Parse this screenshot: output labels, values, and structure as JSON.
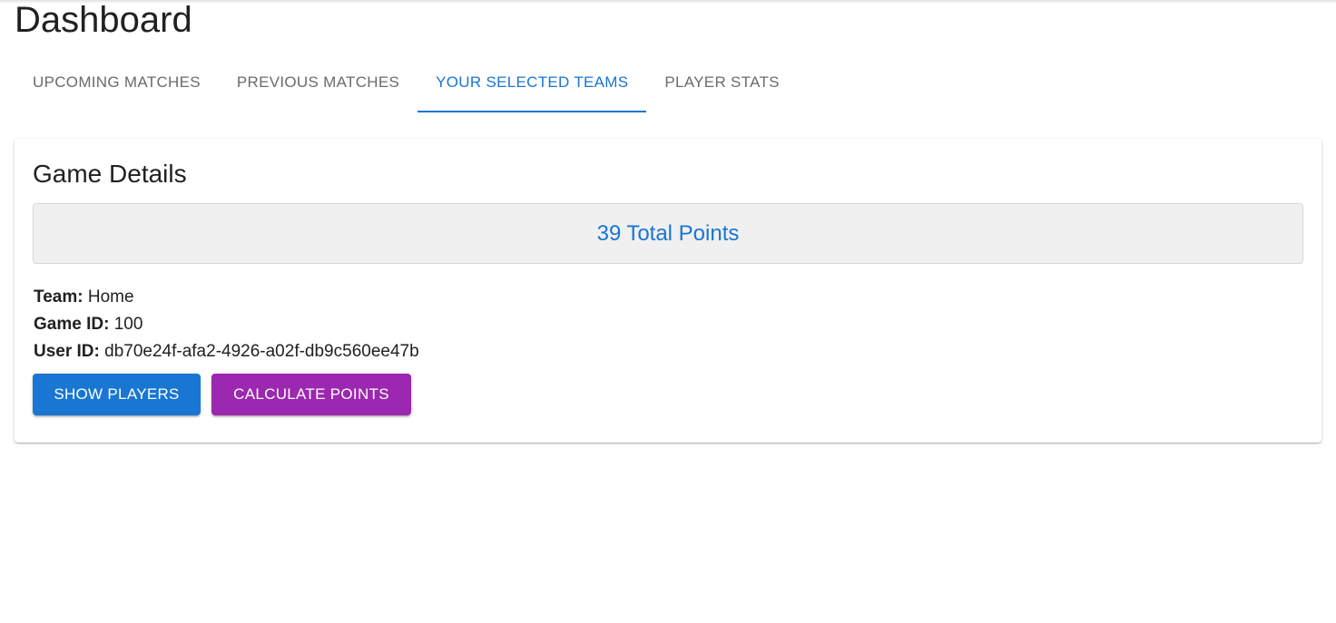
{
  "page": {
    "title": "Dashboard"
  },
  "tabs": [
    {
      "label": "UPCOMING MATCHES",
      "active": false
    },
    {
      "label": "PREVIOUS MATCHES",
      "active": false
    },
    {
      "label": "YOUR SELECTED TEAMS",
      "active": true
    },
    {
      "label": "PLAYER STATS",
      "active": false
    }
  ],
  "card": {
    "title": "Game Details",
    "total_points": {
      "value": "39",
      "label": "Total Points"
    },
    "details": {
      "team": {
        "label": "Team:",
        "value": "Home"
      },
      "game_id": {
        "label": "Game ID:",
        "value": "100"
      },
      "user_id": {
        "label": "User ID:",
        "value": "db70e24f-afa2-4926-a02f-db9c560ee47b"
      }
    },
    "buttons": {
      "show_players": "SHOW PLAYERS",
      "calculate_points": "CALCULATE POINTS"
    }
  },
  "colors": {
    "primary": "#1976d2",
    "secondary": "#9c27b0",
    "points_box_bg": "#f0f0f0"
  }
}
